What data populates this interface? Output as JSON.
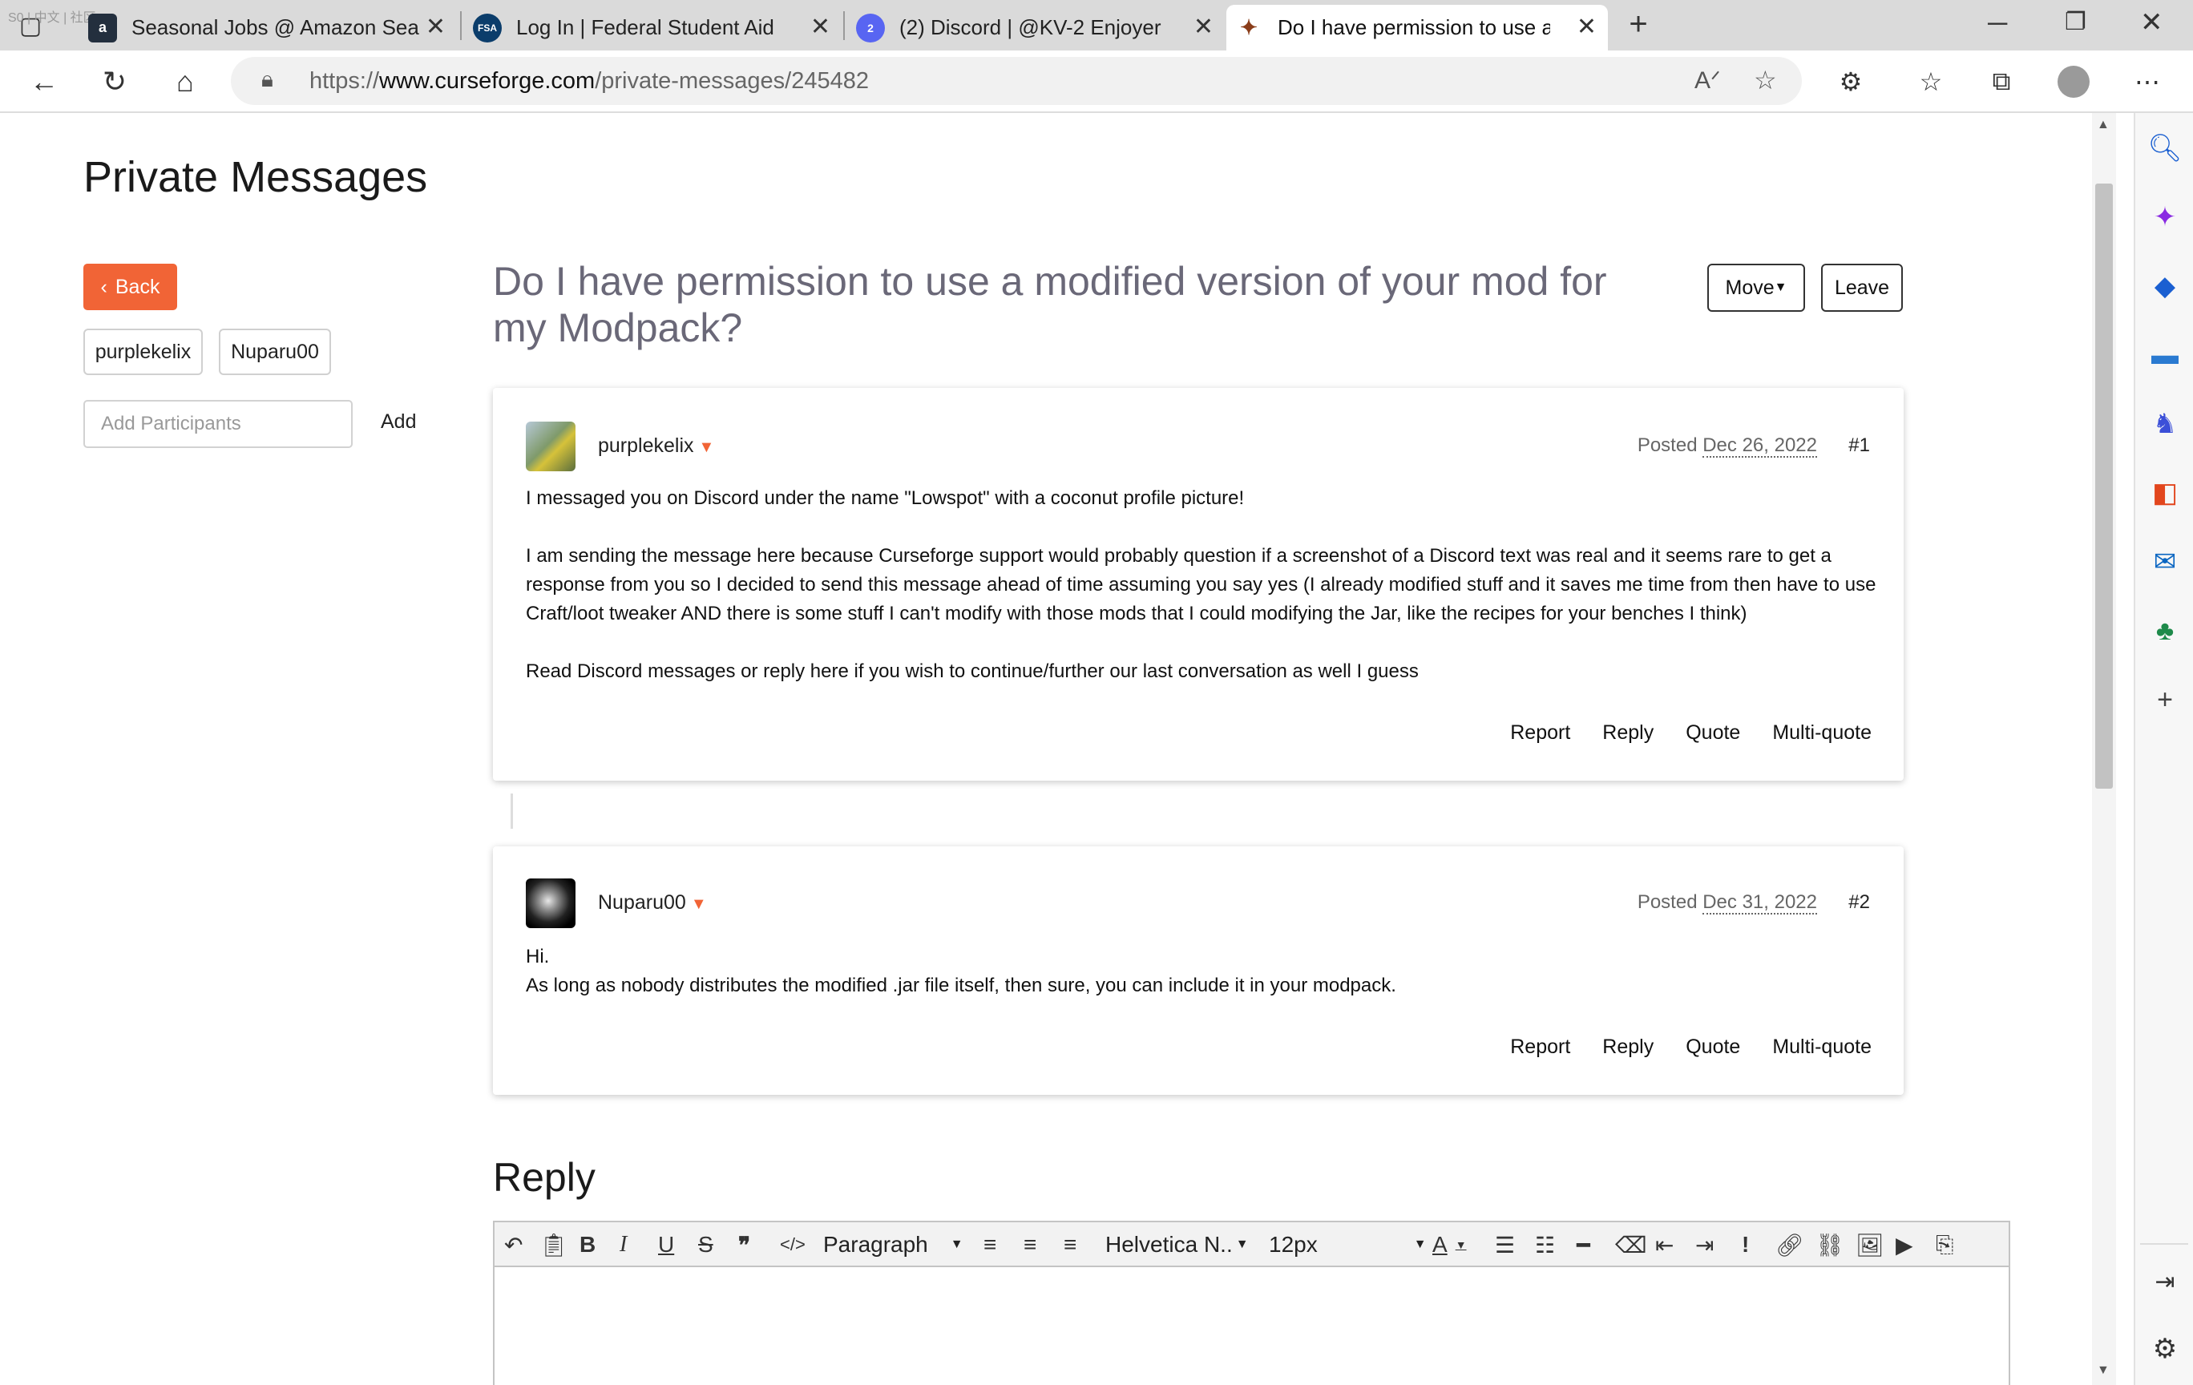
{
  "browser": {
    "overlay_text": "S0 | 中文 | 社区",
    "tabs": [
      {
        "title": "Seasonal Jobs @ Amazon Search",
        "favicon": "a",
        "color": "#232f3e"
      },
      {
        "title": "Log In | Federal Student Aid",
        "favicon": "FSA",
        "color": "#0b3d6b"
      },
      {
        "title": "(2) Discord | @KV-2 Enjoyer",
        "favicon": "2",
        "color": "#5865f2"
      },
      {
        "title": "Do I have permission to use a mo",
        "favicon": "✦",
        "color": "#e8e8e8"
      }
    ],
    "url_prefix": "https://",
    "url_domain": "www.curseforge.com",
    "url_path": "/private-messages/245482"
  },
  "page": {
    "title": "Private Messages",
    "back_label": "Back",
    "participants": [
      "purplekelix",
      "Nuparu00"
    ],
    "add_participants_placeholder": "Add Participants",
    "add_label": "Add",
    "thread_title": "Do I have permission to use a modified version of your mod for my Modpack?",
    "move_label": "Move",
    "leave_label": "Leave",
    "reply_heading": "Reply"
  },
  "messages": [
    {
      "author": "purplekelix",
      "posted_label": "Posted",
      "date": "Dec 26, 2022",
      "number": "#1",
      "paragraphs": [
        "I messaged you on Discord under the name \"Lowspot\" with a coconut profile picture!",
        "I am sending the message here because Curseforge support would probably question if a screenshot of a Discord text was real and it seems rare to get a response from you so I decided to send this message ahead of time assuming you say yes (I already modified stuff and it saves me time from then have to use Craft/loot tweaker AND there is some stuff I can't modify with those mods that I could modifying the Jar, like the recipes for your benches I think)",
        "Read Discord messages or reply here if you wish to continue/further our last conversation as well I guess"
      ],
      "actions": [
        "Report",
        "Reply",
        "Quote",
        "Multi-quote"
      ]
    },
    {
      "author": "Nuparu00",
      "posted_label": "Posted",
      "date": "Dec 31, 2022",
      "number": "#2",
      "paragraphs": [
        "Hi.\nAs long as nobody distributes the modified .jar file itself, then sure, you can include it in your modpack."
      ],
      "actions": [
        "Report",
        "Reply",
        "Quote",
        "Multi-quote"
      ]
    }
  ],
  "editor": {
    "format_select": "Paragraph",
    "font_select": "Helvetica N..",
    "size_select": "12px"
  },
  "colors": {
    "accent": "#f16436",
    "thread_title": "#6a6878"
  }
}
